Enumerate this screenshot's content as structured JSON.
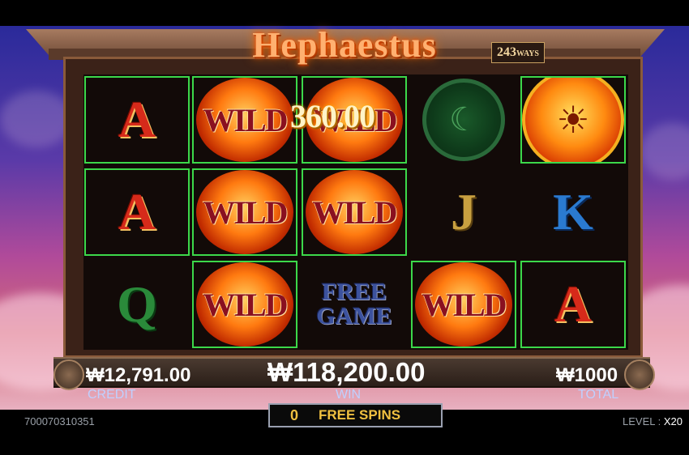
{
  "game": {
    "title": "Hephaestus",
    "ways_number": "243",
    "ways_label": "WAYS"
  },
  "reels": {
    "win_popup": "360.00",
    "wild_label": "WILD",
    "free_game_label_1": "FREE",
    "free_game_label_2": "GAME",
    "rows": [
      [
        {
          "symbol": "A",
          "highlight": true
        },
        {
          "symbol": "WILD",
          "highlight": true
        },
        {
          "symbol": "WILD",
          "highlight": true
        },
        {
          "symbol": "medallion",
          "highlight": false
        },
        {
          "symbol": "hephaestus-face",
          "highlight": true
        }
      ],
      [
        {
          "symbol": "A",
          "highlight": true
        },
        {
          "symbol": "WILD",
          "highlight": true
        },
        {
          "symbol": "WILD",
          "highlight": true
        },
        {
          "symbol": "J",
          "highlight": false
        },
        {
          "symbol": "K",
          "highlight": false
        }
      ],
      [
        {
          "symbol": "Q",
          "highlight": false
        },
        {
          "symbol": "WILD",
          "highlight": true
        },
        {
          "symbol": "FREE GAME",
          "highlight": false
        },
        {
          "symbol": "WILD",
          "highlight": true
        },
        {
          "symbol": "A",
          "highlight": true
        }
      ]
    ]
  },
  "credit": {
    "value": "₩12,791.00",
    "label": "CREDIT"
  },
  "win": {
    "value": "₩118,200.00",
    "label": "WIN"
  },
  "total": {
    "value": "₩1000",
    "label": "TOTAL"
  },
  "free_spins": {
    "count": "0",
    "label": "FREE SPINS"
  },
  "footer": {
    "session_id": "700070310351",
    "level_label": "LEVEL :",
    "level_value": "X20"
  },
  "colors": {
    "highlight": "#3cd84a",
    "accent": "#f0c040"
  }
}
